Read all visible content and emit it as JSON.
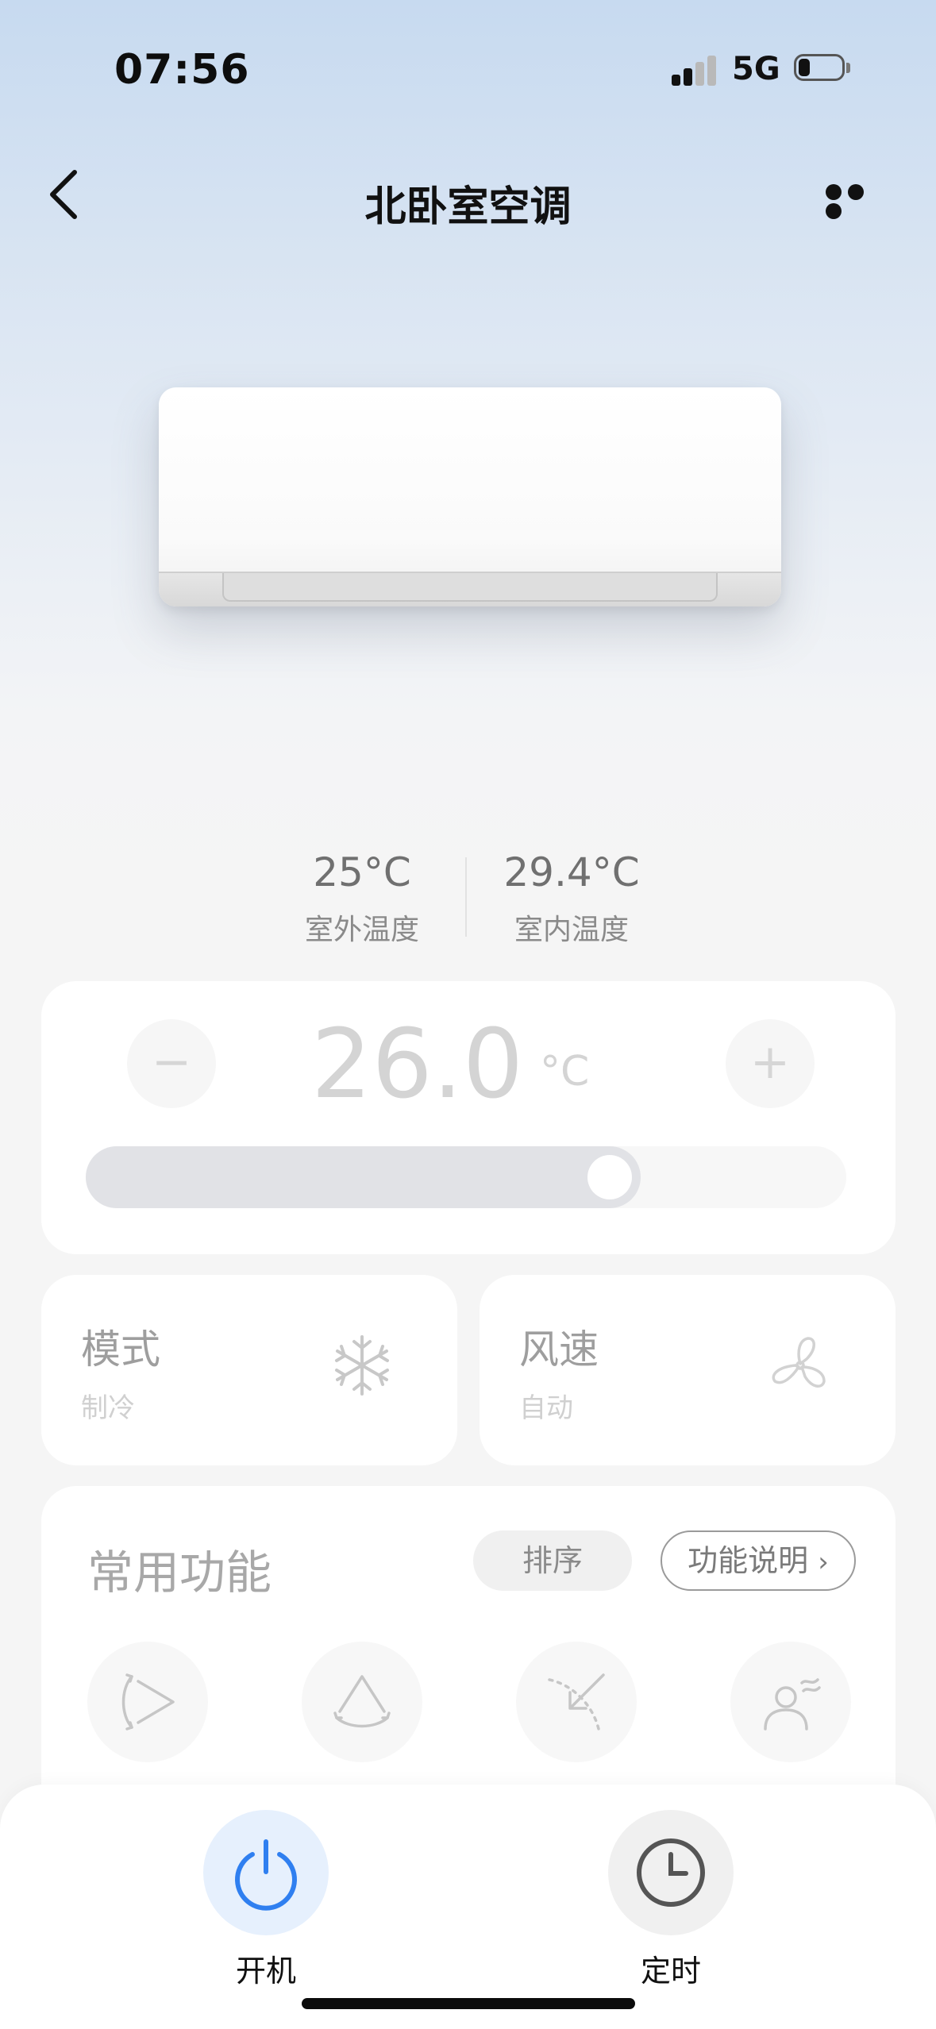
{
  "status_bar": {
    "time": "07:56",
    "network": "5G"
  },
  "header": {
    "title": "北卧室空调"
  },
  "temperatures": {
    "outdoor": {
      "value": "25°C",
      "label": "室外温度"
    },
    "indoor": {
      "value": "29.4°C",
      "label": "室内温度"
    }
  },
  "setpoint": {
    "value": "26.0",
    "unit": "°C",
    "minus": "−",
    "plus": "+",
    "slider_fraction": 0.73
  },
  "mode": {
    "title": "模式",
    "value": "制冷",
    "icon": "snowflake-icon"
  },
  "fan": {
    "title": "风速",
    "value": "自动",
    "icon": "fan-icon"
  },
  "functions": {
    "title": "常用功能",
    "sort_label": "排序",
    "help_label": "功能说明",
    "icons": [
      "swing-horizontal-icon",
      "swing-vertical-icon",
      "air-direction-icon",
      "person-airflow-icon"
    ]
  },
  "bottom_bar": {
    "power_label": "开机",
    "timer_label": "定时",
    "power_color": "#2f7ff0",
    "power_bg": "#e6f0fd",
    "timer_color": "#555555",
    "timer_bg": "#f0f0f0"
  }
}
